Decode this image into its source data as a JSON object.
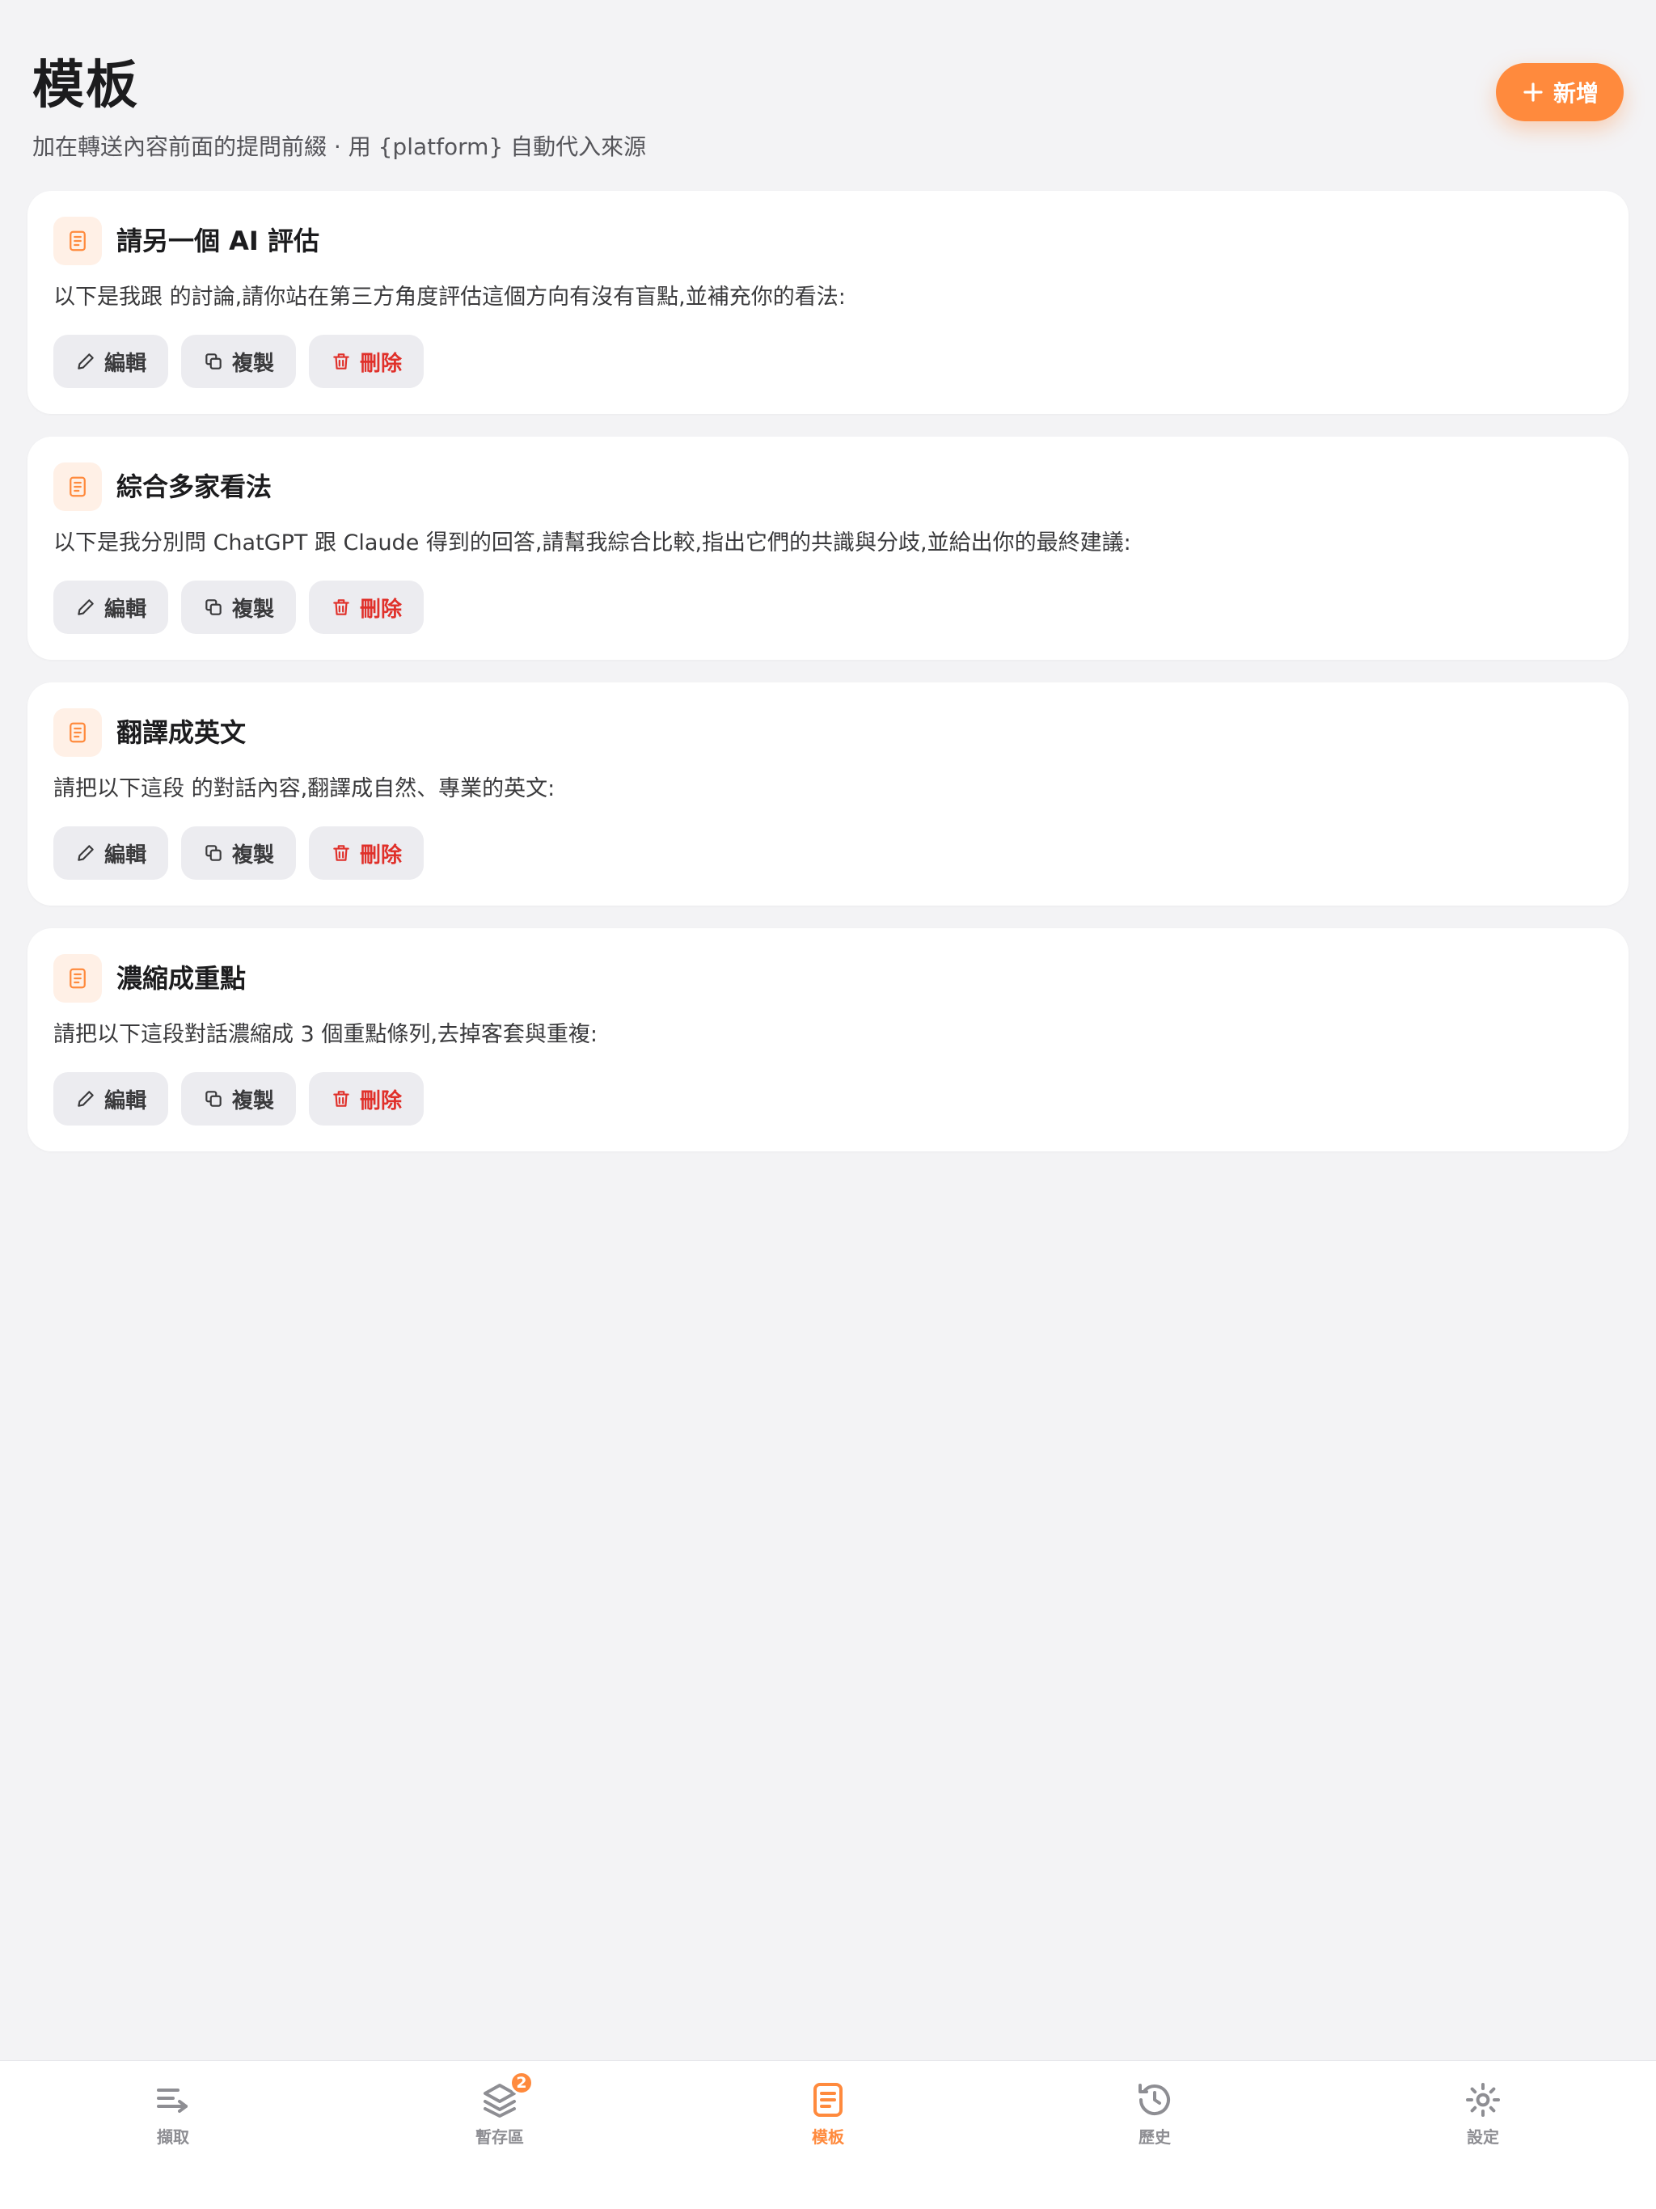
{
  "header": {
    "title": "模板",
    "subtitle": "加在轉送內容前面的提問前綴 · 用 {platform} 自動代入來源",
    "add_label": "新增"
  },
  "templates": [
    {
      "title": "請另一個 AI 評估",
      "body": "以下是我跟  的討論,請你站在第三方角度評估這個方向有沒有盲點,並補充你的看法:",
      "edit": "編輯",
      "copy": "複製",
      "delete": "刪除"
    },
    {
      "title": "綜合多家看法",
      "body": "以下是我分別問 ChatGPT 跟 Claude 得到的回答,請幫我綜合比較,指出它們的共識與分歧,並給出你的最終建議:",
      "edit": "編輯",
      "copy": "複製",
      "delete": "刪除"
    },
    {
      "title": "翻譯成英文",
      "body": "請把以下這段  的對話內容,翻譯成自然、專業的英文:",
      "edit": "編輯",
      "copy": "複製",
      "delete": "刪除"
    },
    {
      "title": "濃縮成重點",
      "body": "請把以下這段對話濃縮成 3 個重點條列,去掉客套與重複:",
      "edit": "編輯",
      "copy": "複製",
      "delete": "刪除"
    }
  ],
  "tabbar": {
    "items": [
      {
        "label": "擷取",
        "icon": "capture-icon"
      },
      {
        "label": "暫存區",
        "icon": "layers-icon",
        "badge": "2"
      },
      {
        "label": "模板",
        "icon": "template-icon",
        "active": true
      },
      {
        "label": "歷史",
        "icon": "history-icon"
      },
      {
        "label": "設定",
        "icon": "settings-icon"
      }
    ]
  },
  "colors": {
    "accent": "#ff8a3d",
    "danger": "#e0302a",
    "background": "#f3f3f5"
  }
}
